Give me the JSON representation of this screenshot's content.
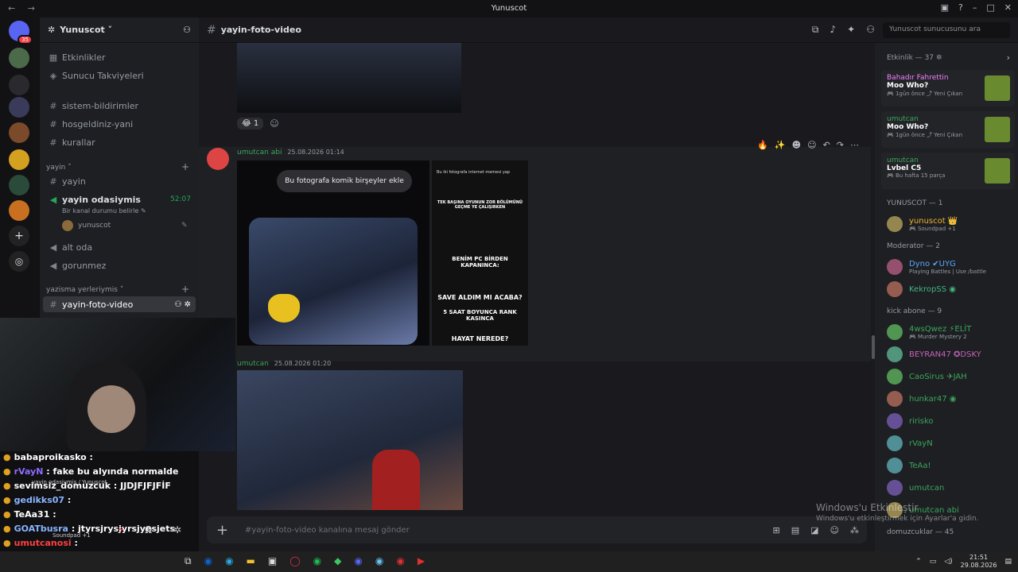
{
  "window": {
    "title": "Yunuscot",
    "nav": "←  →"
  },
  "server": {
    "name": "Yunuscot ˅"
  },
  "channel": {
    "name": "yayin-foto-video",
    "placeholder": "#yayin-foto-video kanalına mesaj gönder",
    "search_placeholder": "Yunuscot sunucusunu ara"
  },
  "sidebar": {
    "top": [
      "Etkinlikler",
      "Sunucu Takviyeleri"
    ],
    "text_channels": [
      "sistem-bildirimler",
      "hosgeldiniz-yani",
      "kurallar"
    ],
    "cat_yayin": "yayin ˅",
    "yayin_channels": [
      "yayin"
    ],
    "voice": {
      "name": "yayin odasiymis",
      "status": "Bir kanal durumu belirle ✎",
      "timer": "52:07",
      "user": "yunuscot"
    },
    "voice2": [
      "alt oda",
      "gorunmez"
    ],
    "cat_yazisma": "yazisma yerleriymis ˅",
    "active": "yayin-foto-video"
  },
  "guild_badge": "35",
  "messages": [
    {
      "author": "umutcan abi",
      "time": "25.08.2026 01:14",
      "reaction_count": "1",
      "meme_left": "Bu fotografa komik birşeyler ekle",
      "meme_right_prompt": "Bu iki fotografa internet memesi yap",
      "meme_right_lines": [
        "TEK BAŞINA OYUNUN ZOR BÖLÜMÜNÜ GEÇME YE ÇALIŞIRKEN",
        "BENİM PC BİRDEN KAPANINCA:",
        "SAVE ALDIM MI ACABA?",
        "5 SAAT BOYUNCA RANK KASINCA",
        "HAYAT NEREDE?"
      ]
    },
    {
      "author": "umutcan",
      "time": "25.08.2026 01:20"
    }
  ],
  "members": {
    "activity_header": "Etkinlik — 37 ✲",
    "activities": [
      {
        "user": "Bahadır Fahrettin",
        "game": "Moo Who?",
        "meta": "🎮 1gün önce  ⤴ Yeni Çıkan"
      },
      {
        "user": "umutcan",
        "game": "Moo Who?",
        "meta": "🎮 1gün önce  ⤴ Yeni Çıkan"
      },
      {
        "user": "umutcan",
        "game": "Lvbel C5",
        "meta": "🎮 Bu hafta 15 parça"
      }
    ],
    "groups": [
      {
        "label": "YUNUSCOT — 1",
        "items": [
          {
            "name": "yunuscot 👑",
            "sub": "🎮 Soundpad +1",
            "color": "#f0b232"
          }
        ]
      },
      {
        "label": "Moderator — 2",
        "items": [
          {
            "name": "Dyno ✔UYG",
            "sub": "Playing Battles | Use /battle",
            "color": "#5aa5ff"
          },
          {
            "name": "KekropSS ◉",
            "sub": "",
            "color": "#43b581"
          }
        ]
      },
      {
        "label": "kick abone — 9",
        "items": [
          {
            "name": "4wsQwez ⚡ELİT",
            "sub": "🎮 Murder Mystery 2",
            "color": "#3ba55c"
          },
          {
            "name": "BEYRAN47 ✪DSKY",
            "sub": "",
            "color": "#c462b8"
          },
          {
            "name": "CaoSirus ✈JAH",
            "sub": "",
            "color": "#3ba55c"
          },
          {
            "name": "hunkar47 ◉",
            "sub": "",
            "color": "#3ba55c"
          },
          {
            "name": "ririsko",
            "sub": "",
            "color": "#3ba55c"
          },
          {
            "name": "rVayN",
            "sub": "",
            "color": "#3ba55c"
          },
          {
            "name": "TeAa!",
            "sub": "",
            "color": "#3ba55c"
          },
          {
            "name": "umutcan",
            "sub": "",
            "color": "#3ba55c"
          },
          {
            "name": "umutcan abi",
            "sub": "",
            "color": "#3ba55c"
          }
        ]
      },
      {
        "label": "domuzcuklar — 45",
        "items": []
      }
    ]
  },
  "overlay_chat": [
    {
      "user": "babaproikasko",
      "text": ":",
      "color": "#ffffff"
    },
    {
      "user": "rVayN",
      "text": ": fake bu alyında normalde",
      "color": "#8e6bff"
    },
    {
      "user": "sevimsiz_domuzcuk",
      "text": ": JJDJFJFJFİF",
      "color": "#ffffff"
    },
    {
      "user": "gedikks07",
      "text": ":",
      "color": "#8ab4ff"
    },
    {
      "user": "TeAa31",
      "text": ":",
      "color": "#ffffff"
    },
    {
      "user": "GOATbusra",
      "text": ": jtyrsjrysjyrsjyesjets",
      "color": "#8ab4ff"
    },
    {
      "user": "umutcanosi",
      "text": ":",
      "color": "#ff4040"
    }
  ],
  "overlay_voice": {
    "channel": "yayin odasiymis / Yunuscot",
    "sub": "Soundpad +1"
  },
  "watermark": {
    "line1": "Windows'u Etkinleştir",
    "line2": "Windows'u etkinleştirmek için Ayarlar'a gidin."
  },
  "taskbar": {
    "time": "21:51",
    "date": "29.08.2026"
  },
  "colors": {
    "accent": "#5865f2",
    "green": "#23a55a",
    "author": "#3ba55c",
    "bg": "#1a1a1e"
  }
}
